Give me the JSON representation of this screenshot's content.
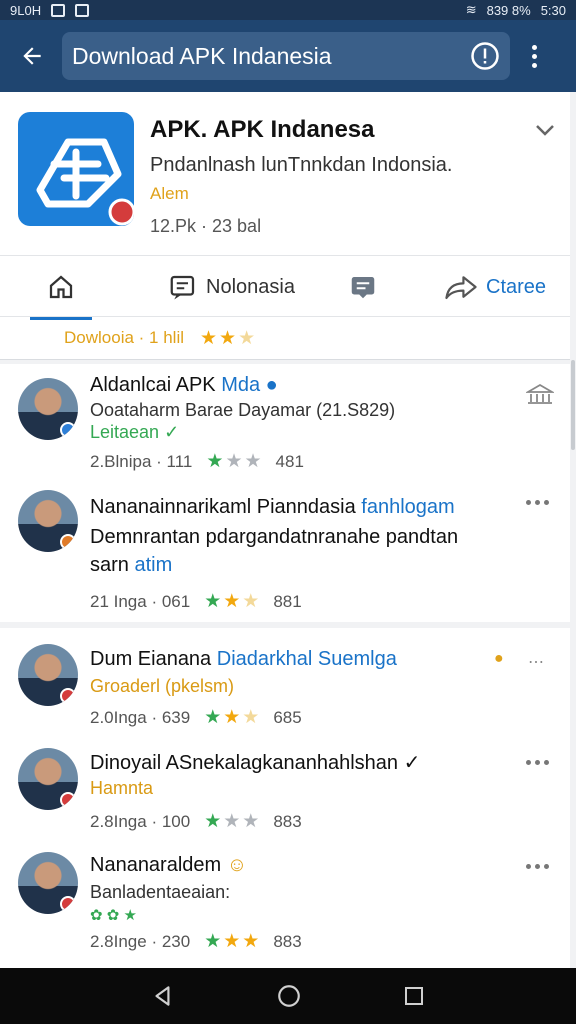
{
  "status_bar": {
    "left_text": "9L0H",
    "right_text": "839 8%",
    "time": "5:30"
  },
  "app_bar": {
    "url_text": "Download APK Indanesia",
    "colors": {
      "bar": "#1f4570",
      "field": "#3a5f89"
    }
  },
  "app": {
    "title": "APK. APK Indanesa",
    "subtitle": "Pndanlnash lunTnnkdan Indonsia.",
    "tag": "Alem",
    "meta": "12.Pk · 23 bal",
    "logo_icon": "apk-logo-icon"
  },
  "tabs": [
    {
      "label": "",
      "icon": "home-icon"
    },
    {
      "label": "Nolonasia",
      "icon": "news-icon"
    },
    {
      "label": "",
      "icon": "message-icon"
    },
    {
      "label": "Ctaree",
      "icon": "share-icon"
    }
  ],
  "rating_strip": {
    "label": "Dowlooia · 1 hlil",
    "stars": "★★★"
  },
  "posts": [
    {
      "title_main": "Aldanlcai APK ",
      "title_accent": "Mda",
      "line1": "Ooataharm Barae Dayamar (21.S829)",
      "line1_accent": "Ooataharm",
      "line2": "Leitaean ✓",
      "meta_left": "2.Blnipa · 111",
      "stars": "★★★",
      "meta_right": "481"
    },
    {
      "title_main": "Nananainnarikaml Pianndasia ",
      "title_accent": "fanhlogam",
      "line1": "Demnrantan pdargandatnranahe pandtan",
      "line2": "sarn atim",
      "meta_left": "21 Inga · 061",
      "stars": "★★★",
      "meta_right": "881"
    },
    {
      "title_main": "Dum Eianana ",
      "title_accent": "Diadarkhal Suemlga",
      "line1": "Groaderl (pkelsm)",
      "meta_left": "2.0Inga · 639",
      "stars": "★★★",
      "meta_right": "685"
    },
    {
      "title_main": "Dinoyail ASnekalagkananhahlshan ✓",
      "title_accent": "",
      "line1": "Hamnta",
      "meta_left": "2.8Inga · 100",
      "stars": "★★★",
      "meta_right": "883"
    },
    {
      "title_main": "Nananaraldem ",
      "title_accent": "",
      "line1": "Banladentaeaian:",
      "line2": "✿ ✿ ★",
      "meta_left": "2.8Inge · 230",
      "stars": "★★★",
      "meta_right": "883"
    }
  ],
  "navigation": {
    "back": "back-nav-icon",
    "home": "home-nav-icon",
    "recents": "recents-nav-icon"
  }
}
